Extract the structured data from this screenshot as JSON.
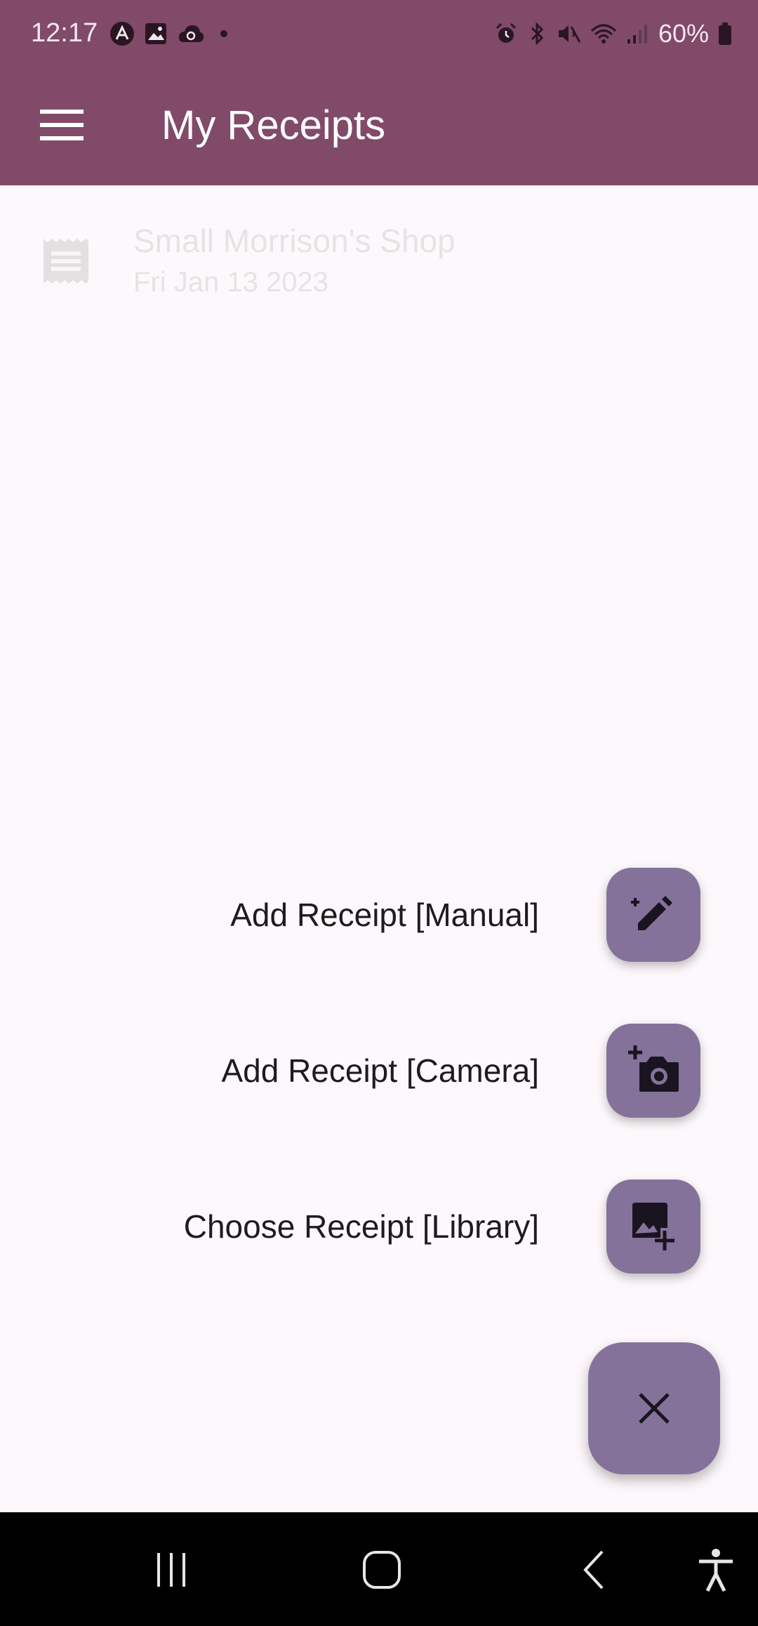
{
  "status_bar": {
    "time": "12:17",
    "battery": "60%",
    "left_icons": [
      "app-notification-icon",
      "image-icon",
      "cloud-sync-icon",
      "dot-icon"
    ],
    "right_icons": [
      "alarm-icon",
      "bluetooth-icon",
      "mute-icon",
      "wifi-icon",
      "signal-icon",
      "battery-icon"
    ]
  },
  "app_bar": {
    "title": "My Receipts",
    "menu_icon": "hamburger-menu-icon"
  },
  "receipts": [
    {
      "title": "Small Morrison's Shop",
      "date": "Fri Jan 13 2023",
      "icon": "receipt-icon"
    }
  ],
  "fab_menu": {
    "actions": [
      {
        "label": "Add Receipt [Manual]",
        "icon": "edit-pencil-icon"
      },
      {
        "label": "Add Receipt [Camera]",
        "icon": "add-photo-camera-icon"
      },
      {
        "label": "Choose Receipt [Library]",
        "icon": "add-image-icon"
      }
    ],
    "close_icon": "close-icon"
  },
  "nav_bar": {
    "buttons": [
      "recent-apps-icon",
      "home-icon",
      "back-icon",
      "accessibility-icon"
    ]
  },
  "colors": {
    "primary": "#814a69",
    "fab": "#84729a",
    "background": "#fdf8fb",
    "nav": "#000000"
  }
}
